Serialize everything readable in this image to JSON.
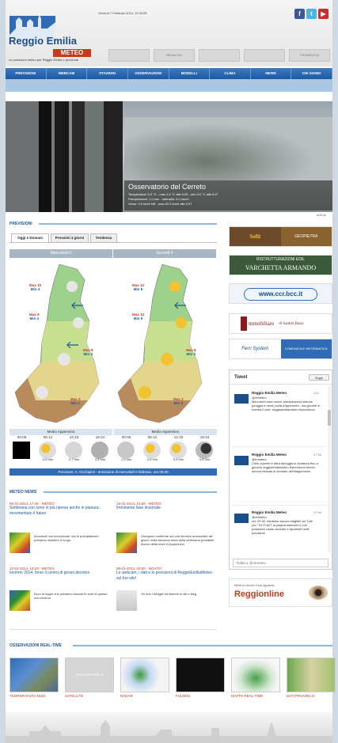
{
  "header": {
    "date": "Venerdì 7 Febbraio 2014, 11:05:05",
    "logo_title": "Reggio Emilia",
    "logo_sub": "METEO",
    "tagline": "Le previsioni meteo per Reggio Emilia e provincia",
    "sponsors": [
      "",
      "REDACON",
      "",
      "",
      "FROMEMTIA"
    ]
  },
  "nav": [
    "PREVISIONI",
    "WEBCAM",
    "STAZIONI",
    "OSSERVAZIONI",
    "MODELLI",
    "CLIMA",
    "NEWS",
    "CHI SIAMO"
  ],
  "hero": {
    "title": "Osservatorio del Cerreto",
    "lines": [
      "Temperatura: 0.0 °C - max 1.4 °C alle 0.00 - min 0.2 °C alle 6.5°",
      "Precipitazioni: 1.0 mm - intensità: 0.0 mm/h",
      "Vento: 0.0 km/h NE - max 22.5 km/h alle 0.07"
    ],
    "source": "ar18.de"
  },
  "forecast": {
    "section": "PREVISIONI",
    "tabs": [
      "Oggi e Domani",
      "Prossimi 3 giorni",
      "Tendenza"
    ],
    "days": [
      "Mercoledì 5",
      "Giovedì 6"
    ],
    "map_left": [
      {
        "max": "Max 10",
        "min": "Min 4"
      },
      {
        "max": "Max 9",
        "min": "Min 4"
      },
      {
        "max": "Max 8",
        "min": "Min 3"
      },
      {
        "max": "Max 3",
        "min": "Min 1"
      }
    ],
    "map_right": [
      {
        "max": "Max 12",
        "min": "Min 6"
      },
      {
        "max": "Max 12",
        "min": "Min 5"
      },
      {
        "max": "Max 8",
        "min": "Min 3"
      },
      {
        "max": "Max 3",
        "min": "Min 0"
      }
    ],
    "zones": [
      "Medio Appennino",
      "Medio Appennino"
    ],
    "slots": [
      "00-06",
      "06-12",
      "12-18",
      "18-24",
      "00-06",
      "06-12",
      "12-18",
      "18-24"
    ],
    "mm": [
      "",
      "0,0 mm",
      "0,7 mm",
      "3,3 mm",
      "1,0 mm",
      "0,0 mm",
      "0,0 mm",
      "0,0 mm"
    ],
    "footer": "Previsore:  A. Occhipinti - emissione di mercoledì 5 febbraio, ore 00.00"
  },
  "ads": {
    "ad1a": "Sofit",
    "ad1b": "GEOPIETRA",
    "ad2a": "RISTRUTTURAZIONI EDIL",
    "ad2b": "VARCHETTA ARMANDO",
    "ad3": "www.ccr.bcc.it",
    "ad4a": "mmobiliare",
    "ad4b": "di Santini Bassi",
    "ad5a": "Ferri System",
    "ad5b": "COMUNICA E INFORMATICA"
  },
  "tweets": {
    "title": "Tweet",
    "follow": "Segui",
    "compose": "Twitta a @remeteo",
    "items": [
      {
        "name": "Reggio Emilia Meteo",
        "handle": "@remeteo",
        "time": "10h",
        "text": "Mercoledì sarà nuove precipitazioni intense (pioggia e neve) sulla #Appennino, ma giovedì si rivedrà il sole: reggioemiliameteo.it/previsioni"
      },
      {
        "name": "Reggio Emilia Meteo",
        "handle": "@remeteo",
        "time": "4 Feb",
        "text": "Cielo coperto e altra #pioggia in #pianura fino a giovedì reggioemiliameteo.it/previsioni #neve ancora limitata al #crinale dell'#appennino"
      },
      {
        "name": "Reggio Emilia Meteo",
        "handle": "@remeteo",
        "time": "3 Feb",
        "text": "ore 20.00: risultano ancora inagibili sul Tubi (ex.\"Tre Fobi\") la pagina webcam e non possiamo usare accente e apostrofi nelle previsioni"
      }
    ]
  },
  "reggio_ad": {
    "pre": "Metti in circolo il tuo sguardo",
    "brand": "Reggionline"
  },
  "news": {
    "section": "METEO NEWS",
    "items": [
      {
        "date": "06-01-2014, 17:46 - METEO",
        "title": "Settimana con neve in più riprese anche in pianura: movimentato il futuro",
        "text": "Accumuli non eccezionali, ma le precipitazioni potranno insistere a lungo"
      },
      {
        "date": "19-01-2014, 21:50 - METEO",
        "title": "Imminente fase invernale",
        "text": "Giungono conferme sul calo termico annunciato da giorni: nella seconda metà della settimana probabile ritorno della neve in Appennino"
      },
      {
        "date": "12-01-2014, 19:29 - METEO",
        "title": "Inverno 2014, forse il centro di gesso decisivo",
        "text": "Ecco le tappe che potranno mutare le sorti di questo non-inverno"
      },
      {
        "date": "08-01-2014, 00:50 - NOVITA'",
        "title": "Le webcam, i dati e le previsioni di ReggioEmiliaMeteo sul tuo sito!",
        "text": "On line i Widget da inserire in siti e blog"
      }
    ]
  },
  "obs": {
    "section": "OSSERVAZIONI REAL-TIME",
    "items": [
      "TEMPERATURA NUDI",
      "SATELLITE",
      "RADAR",
      "FULMINI",
      "MAPPA REAL-TIME",
      "DATI PROVINCIA"
    ],
    "nd": "NON DISPONIBILE"
  },
  "colors": {
    "accent": "#1d58a0",
    "brand_red": "#c53a1c"
  }
}
